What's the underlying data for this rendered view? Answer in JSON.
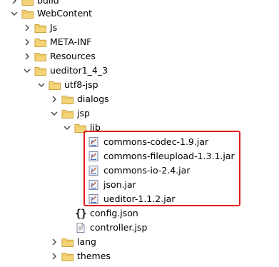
{
  "tree": {
    "items": [
      {
        "label": "build",
        "kind": "folder",
        "state": "collapsed"
      },
      {
        "label": "WebContent",
        "kind": "folder",
        "state": "expanded"
      },
      {
        "label": "Js",
        "kind": "folder",
        "state": "collapsed"
      },
      {
        "label": "META-INF",
        "kind": "folder",
        "state": "collapsed"
      },
      {
        "label": "Resources",
        "kind": "folder",
        "state": "collapsed"
      },
      {
        "label": "ueditor1_4_3",
        "kind": "folder",
        "state": "expanded"
      },
      {
        "label": "utf8-jsp",
        "kind": "folder",
        "state": "expanded"
      },
      {
        "label": "dialogs",
        "kind": "folder",
        "state": "collapsed"
      },
      {
        "label": "jsp",
        "kind": "folder",
        "state": "expanded"
      },
      {
        "label": "lib",
        "kind": "folder",
        "state": "expanded"
      },
      {
        "label": "commons-codec-1.9.jar",
        "kind": "jar"
      },
      {
        "label": "commons-fileupload-1.3.1.jar",
        "kind": "jar"
      },
      {
        "label": "commons-io-2.4.jar",
        "kind": "jar"
      },
      {
        "label": "json.jar",
        "kind": "jar"
      },
      {
        "label": "ueditor-1.1.2.jar",
        "kind": "jar"
      },
      {
        "label": "config.json",
        "kind": "json"
      },
      {
        "label": "controller.jsp",
        "kind": "jsp"
      },
      {
        "label": "lang",
        "kind": "folder",
        "state": "collapsed"
      },
      {
        "label": "themes",
        "kind": "folder",
        "state": "collapsed"
      }
    ]
  },
  "highlight": {
    "color": "#e21d1d"
  },
  "icons": {
    "folder": "folder-icon",
    "jar": "jar-icon",
    "json": "json-file-icon",
    "jsp": "jsp-file-icon",
    "collapsed_arrow": "chevron-right-icon",
    "expanded_arrow": "chevron-down-icon"
  },
  "colors": {
    "folder_fill": "#f5d47a",
    "folder_stroke": "#c9a23c",
    "arrow": "#444444"
  }
}
